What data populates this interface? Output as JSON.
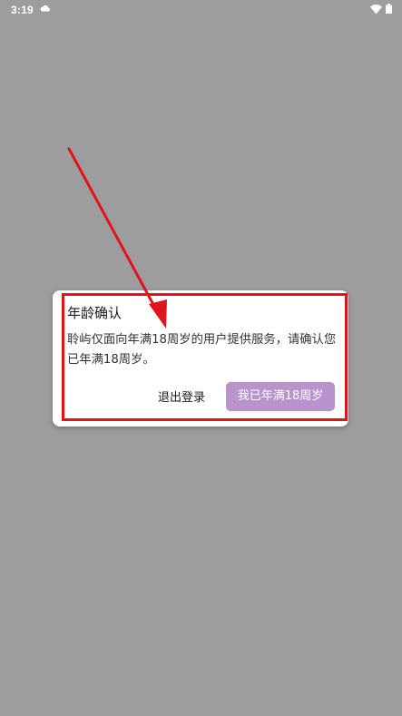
{
  "status_bar": {
    "time": "3:19",
    "icons": [
      "cloud-icon",
      "wifi-icon",
      "battery-icon"
    ]
  },
  "dialog": {
    "title": "年龄确认",
    "message": "聆屿仅面向年满18周岁的用户提供服务，请确认您已年满18周岁。",
    "logout_label": "退出登录",
    "confirm_label": "我已年满18周岁"
  },
  "colors": {
    "backdrop": "#9d9d9f",
    "dialog_background": "#ffffff",
    "confirm_button": "#b993cb",
    "annotation_red": "#e0141a"
  }
}
